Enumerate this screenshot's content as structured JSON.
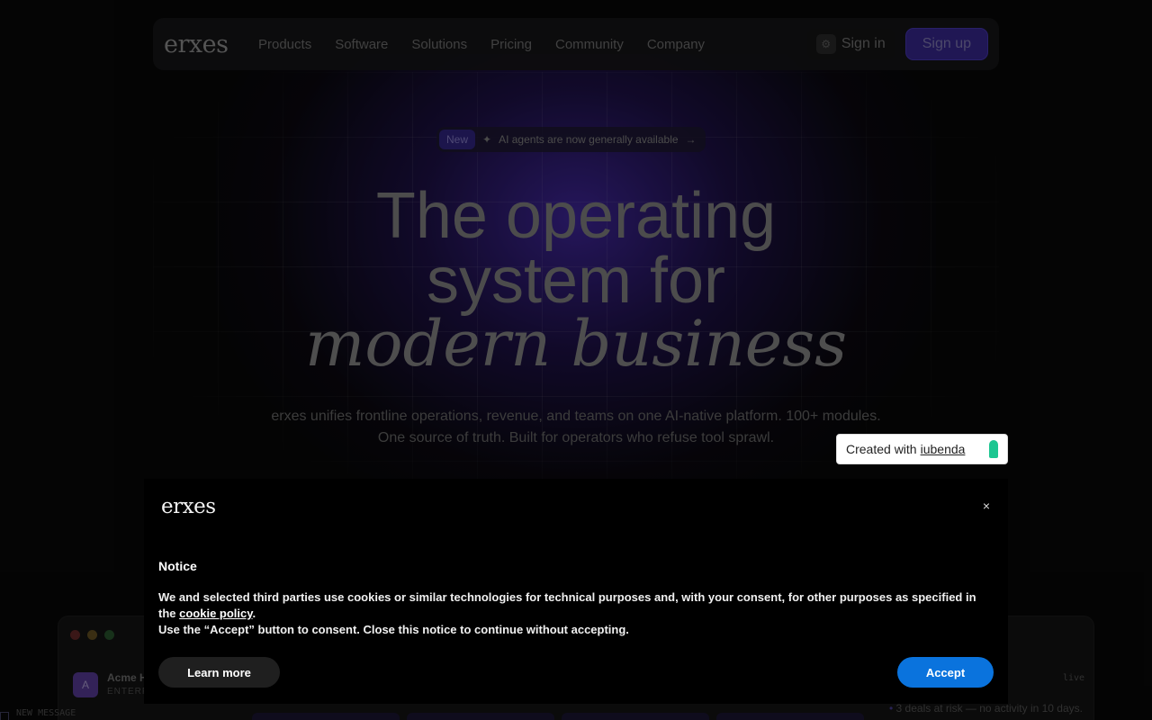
{
  "nav": {
    "logo": "erxes",
    "links": [
      "Products",
      "Software",
      "Solutions",
      "Pricing",
      "Community",
      "Company"
    ],
    "sign_in": "Sign in",
    "sign_up": "Sign up"
  },
  "announcement": {
    "badge": "New",
    "text": "AI agents are now generally available",
    "arrow": "→"
  },
  "hero": {
    "line1": "The operating",
    "line2": "system for",
    "line3": "modern business",
    "subtitle": "erxes unifies frontline operations, revenue, and teams on one AI-native platform. 100+ modules. One source of truth. Built for operators who refuse tool sprawl."
  },
  "iubenda": {
    "prefix": "Created with",
    "link": "iubenda"
  },
  "app_preview": {
    "avatar_letter": "A",
    "account_name": "Acme H",
    "account_plan": "ENTERP",
    "status": "live",
    "deals_text": "3 deals at risk — no activity in 10 days.",
    "new_message": "NEW MESSAGE"
  },
  "cookie": {
    "logo": "erxes",
    "close": "×",
    "title": "Notice",
    "text_before_link": "We and selected third parties use cookies or similar technologies for technical purposes and, with your consent, for other purposes as specified in the ",
    "link": "cookie policy",
    "text_after_link": ".",
    "text_line2": "Use the “Accept” button to consent. Close this notice to continue without accepting.",
    "learn_more": "Learn more",
    "accept": "Accept"
  },
  "colors": {
    "accent": "#3b2a9a",
    "accept_blue": "#0a73dd",
    "iubenda_green": "#1cc691"
  }
}
